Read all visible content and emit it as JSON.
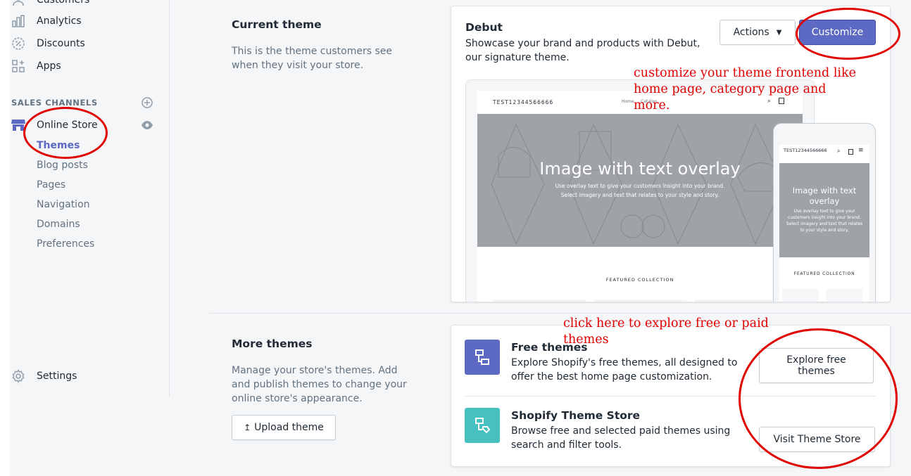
{
  "sidebar": {
    "items": [
      {
        "label": "Customers",
        "icon": "person-icon"
      },
      {
        "label": "Analytics",
        "icon": "bar-chart-icon"
      },
      {
        "label": "Discounts",
        "icon": "discount-icon"
      },
      {
        "label": "Apps",
        "icon": "apps-icon"
      }
    ],
    "sales_channels_heading": "SALES CHANNELS",
    "online_store": "Online Store",
    "sub_items": [
      "Themes",
      "Blog posts",
      "Pages",
      "Navigation",
      "Domains",
      "Preferences"
    ],
    "settings": "Settings"
  },
  "current_theme": {
    "heading": "Current theme",
    "description": "This is the theme customers see when they visit your store.",
    "theme_name": "Debut",
    "theme_desc": "Showcase your brand and products with Debut, our signature theme.",
    "actions_label": "Actions",
    "customize_label": "Customize",
    "preview": {
      "store_name": "TEST12344566666",
      "nav_home": "Home",
      "nav_catalog": "Catalog",
      "hero_title": "Image with text overlay",
      "hero_line1": "Use overlay text to give your customers insight into your brand.",
      "hero_line2": "Select imagery and text that relates to your style and story.",
      "featured": "FEATURED COLLECTION",
      "mobile_store_name": "TEST12344566666",
      "mobile_hero_title": "Image with text overlay",
      "mobile_hero_text": "Use overlay text to give your customers insight into your brand. Select imagery and text that relates to your style and story.",
      "mobile_featured": "FEATURED COLLECTION"
    }
  },
  "more_themes": {
    "heading": "More themes",
    "description": "Manage your store's themes. Add and publish themes to change your online store's appearance.",
    "upload_label": "Upload theme",
    "free": {
      "title": "Free themes",
      "desc": "Explore Shopify's free themes, all designed to offer the best home page customization.",
      "button": "Explore free themes"
    },
    "store": {
      "title": "Shopify Theme Store",
      "desc": "Browse free and selected paid themes using search and filter tools.",
      "button": "Visit Theme Store"
    }
  },
  "annotations": {
    "customize_note": "customize your theme frontend like home page, category page and more.",
    "explore_note": "click here to explore free or paid themes"
  },
  "colors": {
    "primary": "#5c6ac4",
    "free_icon_bg": "#5c6ac4",
    "store_icon_bg": "#47c1bf",
    "annotation": "#e00000"
  }
}
